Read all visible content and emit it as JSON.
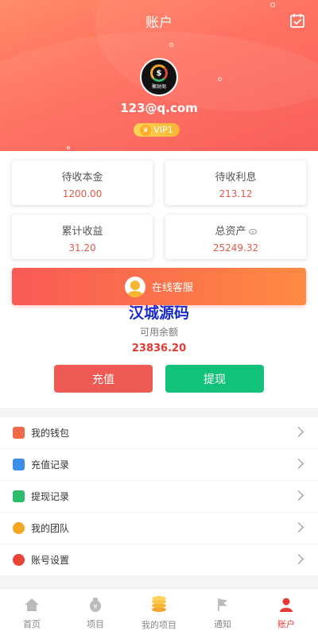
{
  "header": {
    "title": "账户",
    "email": "123@q.com",
    "vip": "VIP1",
    "avatar_brand": "聚财阁"
  },
  "stats": [
    {
      "label": "待收本金",
      "value": "1200.00"
    },
    {
      "label": "待收利息",
      "value": "213.12"
    },
    {
      "label": "累计收益",
      "value": "31.20"
    },
    {
      "label": "总资产",
      "value": "25249.32"
    }
  ],
  "service": {
    "label": "在线客服"
  },
  "watermark": "汉城源码",
  "balance": {
    "label": "可用余额",
    "value": "23836.20",
    "recharge_label": "充值",
    "withdraw_label": "提现"
  },
  "menu": [
    {
      "label": "我的钱包",
      "icon": "wallet-icon",
      "color": "#f06a4a"
    },
    {
      "label": "充值记录",
      "icon": "recharge-record-icon",
      "color": "#3a8ee6"
    },
    {
      "label": "提现记录",
      "icon": "withdraw-record-icon",
      "color": "#2ebd6b"
    },
    {
      "label": "我的团队",
      "icon": "team-icon",
      "color": "#f5a623"
    },
    {
      "label": "账号设置",
      "icon": "settings-icon",
      "color": "#e8443a"
    }
  ],
  "tabs": [
    {
      "label": "首页",
      "icon": "home-icon"
    },
    {
      "label": "项目",
      "icon": "project-icon"
    },
    {
      "label": "我的项目",
      "icon": "my-project-icon"
    },
    {
      "label": "通知",
      "icon": "notice-flag-icon"
    },
    {
      "label": "账户",
      "icon": "account-icon"
    }
  ],
  "colors": {
    "accent": "#f9534f",
    "recharge": "#f05a55",
    "withdraw": "#12c27b",
    "value_red": "#e23b34"
  }
}
